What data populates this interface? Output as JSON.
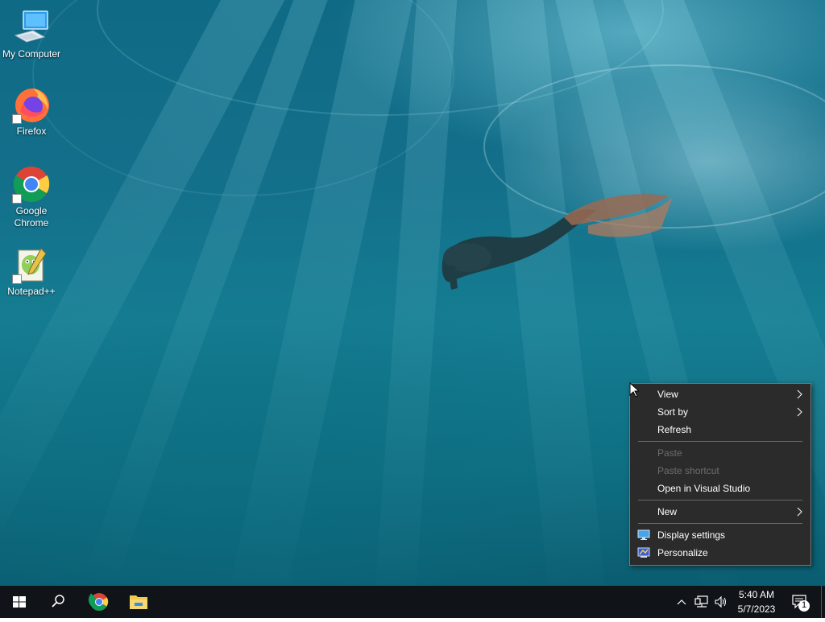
{
  "desktop": {
    "icons": [
      {
        "label": "My Computer",
        "icon": "my-computer-icon"
      },
      {
        "label": "Firefox",
        "icon": "firefox-icon"
      },
      {
        "label": "Google Chrome",
        "icon": "chrome-icon"
      },
      {
        "label": "Notepad++",
        "icon": "notepad-plus-plus-icon"
      }
    ]
  },
  "context_menu": {
    "items": [
      {
        "label": "View",
        "has_submenu": true,
        "enabled": true
      },
      {
        "label": "Sort by",
        "has_submenu": true,
        "enabled": true
      },
      {
        "label": "Refresh",
        "has_submenu": false,
        "enabled": true
      },
      {
        "label": "Paste",
        "has_submenu": false,
        "enabled": false
      },
      {
        "label": "Paste shortcut",
        "has_submenu": false,
        "enabled": false
      },
      {
        "label": "Open in Visual Studio",
        "has_submenu": false,
        "enabled": true
      },
      {
        "label": "New",
        "has_submenu": true,
        "enabled": true
      },
      {
        "label": "Display settings",
        "icon": "display-settings-icon",
        "enabled": true
      },
      {
        "label": "Personalize",
        "icon": "personalize-icon",
        "enabled": true
      }
    ]
  },
  "taskbar": {
    "buttons": [
      {
        "icon": "windows-start-icon"
      },
      {
        "icon": "search-icon"
      },
      {
        "icon": "chrome-icon"
      },
      {
        "icon": "file-explorer-icon"
      }
    ],
    "tray": {
      "icons": [
        "chevron-up-icon",
        "network-icon",
        "volume-icon"
      ],
      "time": "5:40 AM",
      "date": "5/7/2023",
      "notification_count": "1"
    }
  },
  "colors": {
    "menu_bg": "#2b2b2b",
    "menu_text": "#ffffff",
    "menu_disabled": "#6d6d6d",
    "taskbar_bg": "#101418"
  }
}
